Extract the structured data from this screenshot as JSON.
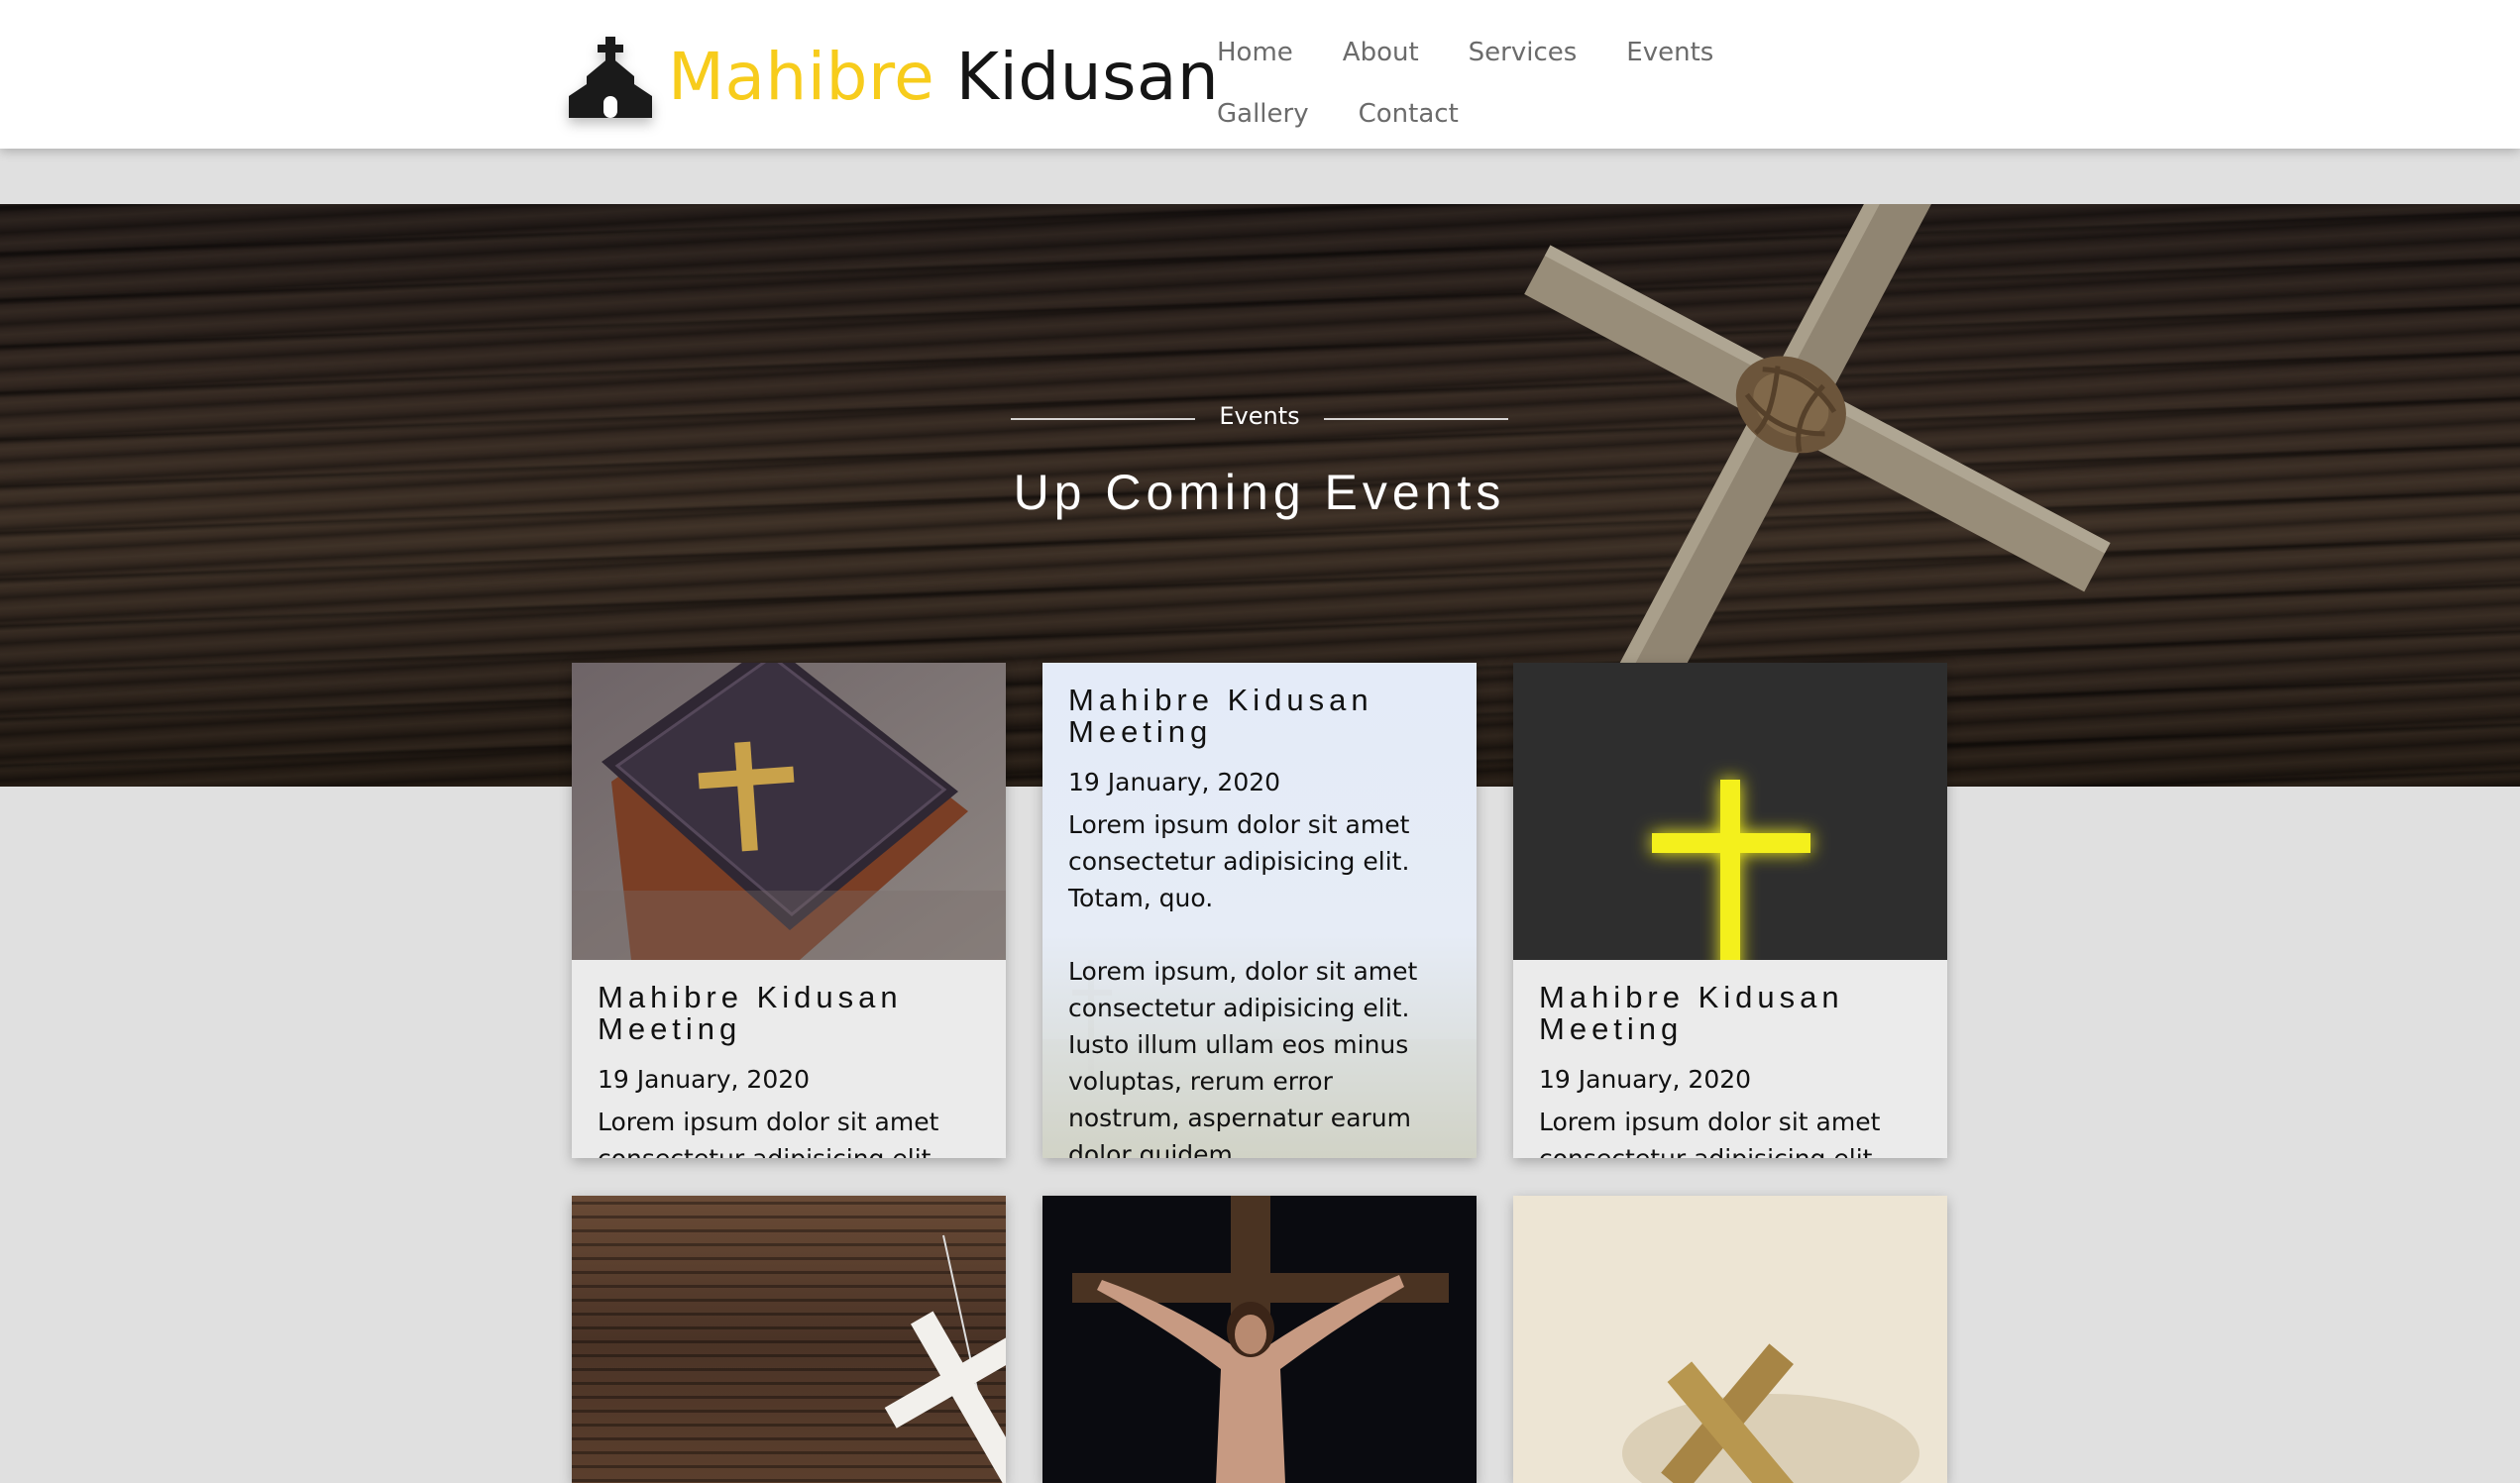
{
  "header": {
    "brand_part1": "Mahibre",
    "brand_part2": "Kidusan",
    "logo_icon": "church-icon",
    "nav": [
      "Home",
      "About",
      "Services",
      "Events",
      "Gallery",
      "Contact"
    ]
  },
  "hero": {
    "label": "Events",
    "title": "Up Coming Events"
  },
  "cards": [
    {
      "title": "Mahibre Kidusan Meeting",
      "date": "19 January, 2020",
      "text": "Lorem ipsum dolor sit amet consectetur adipisicing elit.",
      "image": "bible-with-cross"
    },
    {
      "title": "Mahibre Kidusan Meeting",
      "date": "19 January, 2020",
      "text": "Lorem ipsum dolor sit amet consectetur adipisicing elit. Totam, quo.",
      "text2": "Lorem ipsum, dolor sit amet consectetur adipisicing elit. Iusto illum ullam eos minus voluptas, rerum error nostrum, aspernatur earum dolor quidem",
      "image": "crosses-landscape"
    },
    {
      "title": "Mahibre Kidusan Meeting",
      "date": "19 January, 2020",
      "text": "Lorem ipsum dolor sit amet consectetur adipisicing elit.",
      "image": "glowing-yellow-cross"
    },
    {
      "image": "wooden-cross-on-rope"
    },
    {
      "image": "crucifix"
    },
    {
      "image": "wooden-cross-parchment"
    }
  ],
  "colors": {
    "brand_yellow": "#f7cc1c",
    "brand_dark": "#151515",
    "nav_text": "#6b6b6b",
    "page_bg": "#e0e0e0"
  }
}
